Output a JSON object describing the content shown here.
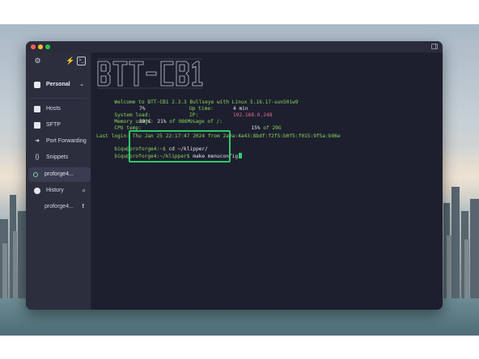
{
  "sidebar": {
    "vault_label": "Personal",
    "items": [
      {
        "label": "Hosts",
        "icon": "hosts-icon"
      },
      {
        "label": "SFTP",
        "icon": "folder-icon"
      },
      {
        "label": "Port Forwarding",
        "icon": "arrow-icon"
      },
      {
        "label": "Snippets",
        "icon": "braces-icon"
      }
    ],
    "active_session": "proforge4...",
    "history_label": "History",
    "history_items": [
      {
        "label": "proforge4...",
        "badge": "!"
      }
    ]
  },
  "terminal": {
    "welcome": {
      "prefix": "Welcome to ",
      "os": "BTT-CB1 2.3.3 Bullseye",
      "mid": " with ",
      "kernel": "Linux 5.16.17-sun50iw9"
    },
    "stats": {
      "system_load": {
        "label": "System load:",
        "value": "7%"
      },
      "memory_usage": {
        "label": "Memory usage:",
        "value": "21%",
        "suffix": " of 986M"
      },
      "cpu_temp": {
        "label": "CPU temp:",
        "value": "39°C"
      },
      "up_time": {
        "label": "Up time:",
        "value": "4 min"
      },
      "ip": {
        "label": "IP:",
        "value": "192.168.0.248"
      },
      "usage": {
        "label": "Usage of /:",
        "value": "15%",
        "suffix": " of 29G"
      }
    },
    "last_login": "Last login: Thu Jan 25 22:17:47 2024 from 2a0a:4a43:8bdf:f2f5:b0f5:f015:9f5a:b96e",
    "lines": [
      {
        "prompt": "biqu@proforge4:~$",
        "command": " cd ~/klipper/"
      },
      {
        "prompt": "biqu@proforge4:~/klipper$",
        "command": " make menuconfig"
      }
    ]
  },
  "colors": {
    "accent_green": "#31c76b",
    "terminal_bg": "#1d1f2e",
    "sidebar_bg": "#2c2e3e"
  }
}
